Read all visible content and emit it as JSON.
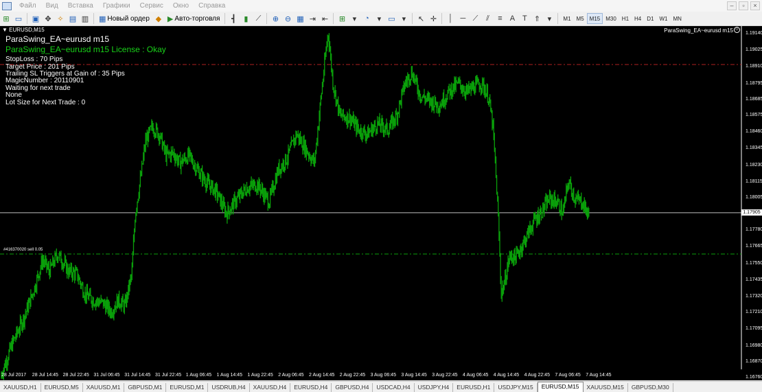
{
  "menu": {
    "items": [
      "Файл",
      "Вид",
      "Вставка",
      "Графики",
      "Сервис",
      "Окно",
      "Справка"
    ],
    "window_buttons": [
      "–",
      "▫",
      "×"
    ]
  },
  "toolbar": {
    "new_order_label": "Новый ордер",
    "auto_trading_label": "Авто-торговля",
    "timeframes": [
      "M1",
      "M5",
      "M15",
      "M30",
      "H1",
      "H4",
      "D1",
      "W1",
      "MN"
    ],
    "active_timeframe": "M15"
  },
  "chart": {
    "symbol_label": "EURUSD,M15",
    "ea_name": "ParaSwing_EA~eurusd m15",
    "overlay": {
      "title": "ParaSwing_EA~eurusd m15",
      "license": "ParaSwing_EA~eurusd m15 License : Okay",
      "lines": [
        "StopLoss : 70 Pips",
        "Target Price : 201 Pips",
        "Trailing SL Triggers at Gain of : 35 Pips",
        "MagicNumber : 20110901",
        "Waiting for next trade",
        "None",
        "Lot Size for Next Trade : 0"
      ]
    },
    "order_line_label": "#416370020 sell 0.05",
    "current_price": "1.17905",
    "price_axis": [
      "1.19140",
      "1.19025",
      "1.18910",
      "1.18795",
      "1.18685",
      "1.18575",
      "1.18460",
      "1.18345",
      "1.18230",
      "1.18115",
      "1.18005",
      "1.17780",
      "1.17665",
      "1.17550",
      "1.17435",
      "1.17320",
      "1.17210",
      "1.17095",
      "1.16980",
      "1.16870",
      "1.16760"
    ],
    "time_axis": [
      "28 Jul 2017",
      "28 Jul 14:45",
      "28 Jul 22:45",
      "31 Jul 06:45",
      "31 Jul 14:45",
      "31 Jul 22:45",
      "1 Aug 06:45",
      "1 Aug 14:45",
      "1 Aug 22:45",
      "2 Aug 06:45",
      "2 Aug 14:45",
      "2 Aug 22:45",
      "3 Aug 06:45",
      "3 Aug 14:45",
      "3 Aug 22:45",
      "4 Aug 06:45",
      "4 Aug 14:45",
      "4 Aug 22:45",
      "7 Aug 06:45",
      "7 Aug 14:45"
    ],
    "colors": {
      "candles": "#0aa00a",
      "background": "#000000",
      "sl_line": "#b02020",
      "order_line": "#0aa00a",
      "bid_line": "#c0c0c0",
      "license_text": "#19d219"
    },
    "series_anchors": [
      [
        0,
        1.1676
      ],
      [
        18,
        1.17
      ],
      [
        35,
        1.1718
      ],
      [
        50,
        1.1738
      ],
      [
        62,
        1.1758
      ],
      [
        72,
        1.175
      ],
      [
        84,
        1.1762
      ],
      [
        100,
        1.175
      ],
      [
        112,
        1.1748
      ],
      [
        124,
        1.1734
      ],
      [
        136,
        1.173
      ],
      [
        150,
        1.1728
      ],
      [
        162,
        1.1722
      ],
      [
        172,
        1.173
      ],
      [
        182,
        1.1726
      ],
      [
        192,
        1.1748
      ],
      [
        197,
        1.179
      ],
      [
        205,
        1.1815
      ],
      [
        212,
        1.184
      ],
      [
        222,
        1.185
      ],
      [
        232,
        1.1845
      ],
      [
        242,
        1.183
      ],
      [
        252,
        1.1832
      ],
      [
        262,
        1.1825
      ],
      [
        275,
        1.183
      ],
      [
        288,
        1.182
      ],
      [
        300,
        1.1812
      ],
      [
        315,
        1.1805
      ],
      [
        330,
        1.179
      ],
      [
        345,
        1.18
      ],
      [
        360,
        1.1808
      ],
      [
        375,
        1.181
      ],
      [
        392,
        1.1798
      ],
      [
        405,
        1.182
      ],
      [
        418,
        1.1828
      ],
      [
        432,
        1.1845
      ],
      [
        445,
        1.1835
      ],
      [
        458,
        1.1825
      ],
      [
        468,
        1.1872
      ],
      [
        478,
        1.1916
      ],
      [
        485,
        1.188
      ],
      [
        495,
        1.1858
      ],
      [
        510,
        1.1856
      ],
      [
        522,
        1.1848
      ],
      [
        535,
        1.1845
      ],
      [
        550,
        1.1852
      ],
      [
        565,
        1.1848
      ],
      [
        578,
        1.1858
      ],
      [
        590,
        1.188
      ],
      [
        600,
        1.1888
      ],
      [
        612,
        1.1872
      ],
      [
        625,
        1.1868
      ],
      [
        640,
        1.1865
      ],
      [
        655,
        1.1875
      ],
      [
        668,
        1.188
      ],
      [
        680,
        1.1874
      ],
      [
        692,
        1.1878
      ],
      [
        702,
        1.188
      ],
      [
        712,
        1.187
      ],
      [
        718,
        1.185
      ],
      [
        722,
        1.182
      ],
      [
        726,
        1.1785
      ],
      [
        730,
        1.1735
      ],
      [
        735,
        1.1742
      ],
      [
        742,
        1.176
      ],
      [
        752,
        1.176
      ],
      [
        765,
        1.1772
      ],
      [
        778,
        1.1785
      ],
      [
        790,
        1.1792
      ],
      [
        800,
        1.18
      ],
      [
        812,
        1.1798
      ],
      [
        820,
        1.179
      ],
      [
        828,
        1.1812
      ],
      [
        838,
        1.18
      ],
      [
        848,
        1.1798
      ],
      [
        858,
        1.1788
      ]
    ]
  },
  "tabs": {
    "items": [
      "XAUUSD,H1",
      "EURUSD,M5",
      "XAUUSD,M1",
      "GBPUSD,M1",
      "EURUSD,M1",
      "USDRUB,H4",
      "XAUUSD,H4",
      "EURUSD,H4",
      "GBPUSD,H4",
      "USDCAD,H4",
      "USDJPY,H4",
      "EURUSD,H1",
      "USDJPY,M15",
      "EURUSD,M15",
      "XAUUSD,M15",
      "GBPUSD,M30"
    ],
    "active": "EURUSD,M15"
  }
}
